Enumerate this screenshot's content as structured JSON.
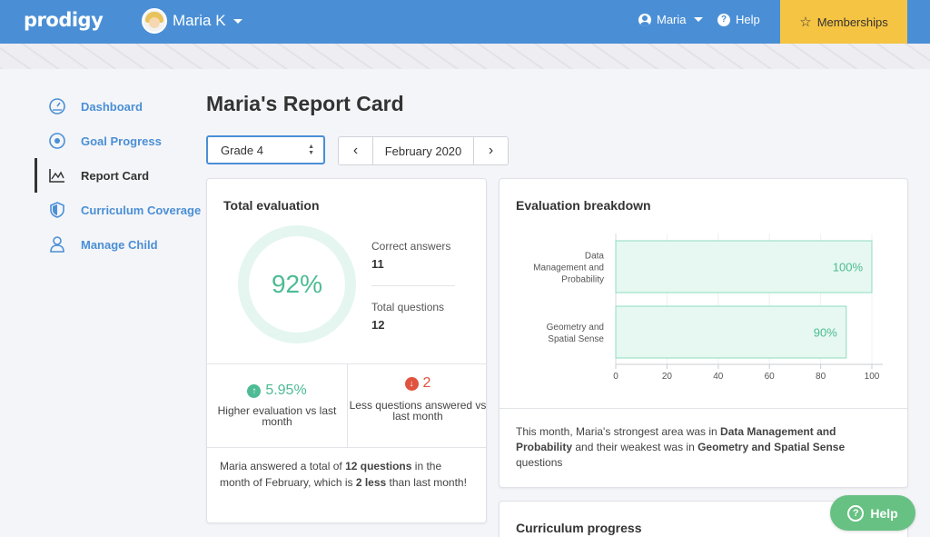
{
  "header": {
    "logo": "prodigy",
    "child_name": "Maria K",
    "account_name": "Maria",
    "help_label": "Help",
    "memberships_label": "Memberships",
    "bar_color": "#4a8fd6",
    "memberships_color": "#f6c443"
  },
  "sidebar": {
    "items": [
      {
        "label": "Dashboard",
        "icon": "gauge-icon",
        "active": false
      },
      {
        "label": "Goal Progress",
        "icon": "target-icon",
        "active": false
      },
      {
        "label": "Report Card",
        "icon": "chart-icon",
        "active": true
      },
      {
        "label": "Curriculum Coverage",
        "icon": "shield-icon",
        "active": false
      },
      {
        "label": "Manage Child",
        "icon": "person-icon",
        "active": false
      }
    ]
  },
  "page": {
    "title": "Maria's Report Card",
    "grade_select": "Grade 4",
    "month": "February 2020"
  },
  "total_evaluation": {
    "title": "Total evaluation",
    "score": "92%",
    "correct_label": "Correct answers",
    "correct_value": "11",
    "total_label": "Total questions",
    "total_value": "12",
    "delta_eval": "5.95%",
    "delta_eval_caption": "Higher evaluation vs last month",
    "delta_questions": "2",
    "delta_questions_caption": "Less questions answered vs last month",
    "summary": {
      "p1": "Maria answered a total of ",
      "b1": "12 questions",
      "p2": " in the month of February, which is ",
      "b2": "2 less",
      "p3": " than last month!"
    },
    "accent_color": "#4dbb94",
    "negative_color": "#e0533f"
  },
  "breakdown": {
    "title": "Evaluation breakdown",
    "summary": {
      "p1": "This month, Maria's strongest area was in ",
      "b1": "Data Management and Probability",
      "p2": " and their weakest was in ",
      "b2": "Geometry and Spatial Sense",
      "p3": " questions"
    }
  },
  "curriculum": {
    "title": "Curriculum progress"
  },
  "help_fab": "Help",
  "chart_data": {
    "type": "bar",
    "orientation": "horizontal",
    "categories": [
      [
        "Data",
        "Management and",
        "Probability"
      ],
      [
        "Geometry and",
        "Spatial Sense"
      ]
    ],
    "values": [
      100,
      90
    ],
    "value_labels": [
      "100%",
      "90%"
    ],
    "xlim": [
      0,
      100
    ],
    "xticks": [
      0,
      20,
      40,
      60,
      80,
      100
    ],
    "title": "",
    "xlabel": "",
    "ylabel": "",
    "bar_color": "#e6f8f1",
    "bar_border": "#8fdcc0",
    "label_color": "#4dbb94"
  }
}
